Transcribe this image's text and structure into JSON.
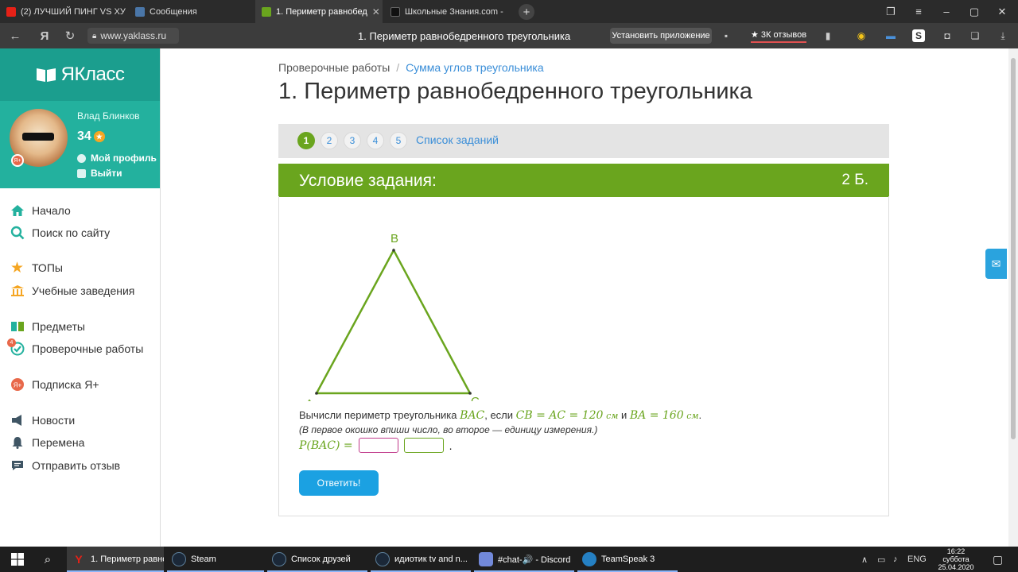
{
  "browser": {
    "tabs": [
      {
        "label": "(2) ЛУЧШИЙ ПИНГ VS ХУ",
        "fav_color": "#e62117"
      },
      {
        "label": "Сообщения",
        "fav_color": "#4a76a8"
      },
      {
        "label": "1. Периметр равнобед",
        "fav_color": "#6aa51e"
      },
      {
        "label": "Школьные Знания.com - ",
        "fav_color": "#111111"
      }
    ],
    "url": "www.yaklass.ru",
    "page_title": "1. Периметр равнобедренного треугольника",
    "install_label": "Установить приложение",
    "reviews_label": "★ 3К отзывов"
  },
  "sidebar": {
    "logo": "ЯКласс",
    "user": {
      "name": "Влад Блинков",
      "points": "34",
      "profile_label": "Мой профиль",
      "logout_label": "Выйти",
      "badge": "Я+"
    },
    "items": [
      {
        "label": "Начало",
        "icon": "home-icon"
      },
      {
        "label": "Поиск по сайту",
        "icon": "search-icon"
      },
      {
        "label": "ТОПы",
        "icon": "star-icon"
      },
      {
        "label": "Учебные заведения",
        "icon": "school-icon"
      },
      {
        "label": "Предметы",
        "icon": "books-icon"
      },
      {
        "label": "Проверочные работы",
        "icon": "check-icon",
        "badge": "4"
      },
      {
        "label": "Подписка Я+",
        "icon": "subscription-icon"
      },
      {
        "label": "Новости",
        "icon": "megaphone-icon"
      },
      {
        "label": "Перемена",
        "icon": "bell-icon"
      },
      {
        "label": "Отправить отзыв",
        "icon": "feedback-icon"
      }
    ]
  },
  "main": {
    "breadcrumb": {
      "root": "Проверочные работы",
      "sep": "/",
      "current": "Сумма углов треугольника"
    },
    "title": "1. Периметр равнобедренного треугольника",
    "pager": {
      "pages": [
        "1",
        "2",
        "3",
        "4",
        "5"
      ],
      "active": "1",
      "task_list": "Список заданий"
    },
    "condition": {
      "heading": "Условие задания:",
      "points": "2 Б."
    },
    "triangle": {
      "a": "A",
      "b": "B",
      "c": "C"
    },
    "question": {
      "prefix": "Вычисли периметр треугольника ",
      "tri": "BAC",
      "mid": ", если ",
      "cond1": "CB = AC = 120",
      "unit1": "см",
      "and": " и ",
      "cond2": "BA = 160",
      "unit2": "см",
      "end": "."
    },
    "hint": "(В первое окошко впиши число, во второе — единицу измерения.)",
    "answer_expr": "P(BAC) =",
    "answer_end": ".",
    "submit_label": "Ответить!"
  },
  "taskbar": {
    "items": [
      {
        "label": "1. Периметр равно...",
        "color": "#e62117"
      },
      {
        "label": "Steam",
        "color": "#1b2838"
      },
      {
        "label": "Список друзей",
        "color": "#1b2838"
      },
      {
        "label": "идиотик tv and n...",
        "color": "#1b2838"
      },
      {
        "label": "#chat-🔊 - Discord",
        "color": "#7289da"
      },
      {
        "label": "TeamSpeak 3",
        "color": "#2580c3"
      }
    ],
    "lang": "ENG",
    "time": "16:22",
    "day": "суббота",
    "date": "25.04.2020"
  }
}
